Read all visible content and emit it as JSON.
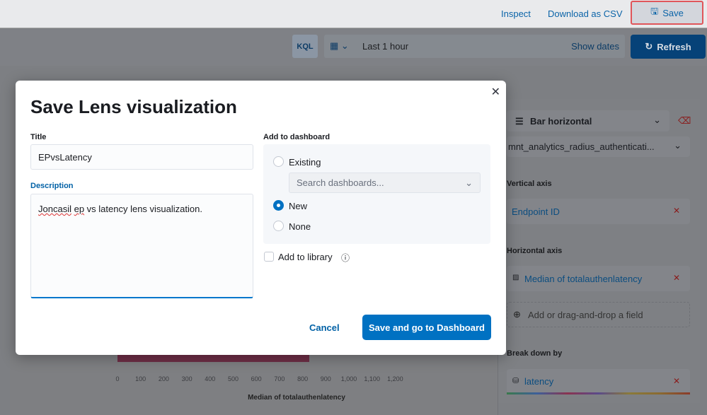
{
  "header": {
    "inspect": "Inspect",
    "download_csv": "Download as CSV",
    "save": "Save"
  },
  "query": {
    "language": "KQL",
    "time_range": "Last 1 hour",
    "show_dates": "Show dates",
    "refresh": "Refresh"
  },
  "chart": {
    "xlabel": "Median of totalauthenlatency",
    "ticks": [
      "0",
      "100",
      "200",
      "300",
      "400",
      "500",
      "600",
      "700",
      "800",
      "900",
      "1,000",
      "1,100",
      "1,200"
    ],
    "bar_value": 830,
    "bar_color": "#6e2e46"
  },
  "config_panel": {
    "chart_type": "Bar horizontal",
    "index_pattern": "mnt_analytics_radius_authenticati...",
    "vertical_axis_label": "Vertical axis",
    "vertical_field": "Endpoint ID",
    "horizontal_axis_label": "Horizontal axis",
    "horizontal_field": "Median of totalauthenlatency",
    "add_field": "Add or drag-and-drop a field",
    "breakdown_label": "Break down by",
    "breakdown_field": "latency"
  },
  "modal": {
    "title": "Save Lens visualization",
    "title_label": "Title",
    "title_value": "EPvsLatency",
    "description_label": "Description",
    "description_misspelled": "Joncasil",
    "description_word2": "ep",
    "description_rest": " vs latency lens visualization.",
    "dashboard_label": "Add to dashboard",
    "options": [
      {
        "label": "Existing",
        "selected": false
      },
      {
        "label": "New",
        "selected": true
      },
      {
        "label": "None",
        "selected": false
      }
    ],
    "search_placeholder": "Search dashboards...",
    "add_to_library": "Add to library",
    "add_to_library_checked": false,
    "cancel": "Cancel",
    "confirm": "Save and go to Dashboard"
  },
  "colors": {
    "primary": "#0071c2",
    "accent_border": "#e0555a"
  }
}
